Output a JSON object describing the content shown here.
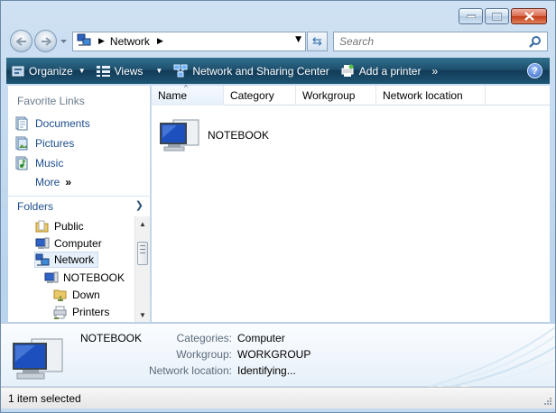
{
  "window": {
    "buttons": {
      "minimize": "minimize-icon",
      "maximize": "maximize-icon",
      "close": "close-icon"
    }
  },
  "address_bar": {
    "location": "Network",
    "search_placeholder": "Search"
  },
  "toolbar": {
    "organize": "Organize",
    "views": "Views",
    "network_sharing": "Network and Sharing Center",
    "add_printer": "Add a printer",
    "overflow": "»",
    "help": "?"
  },
  "favorites": {
    "title": "Favorite Links",
    "items": [
      {
        "label": "Documents",
        "icon": "documents-icon"
      },
      {
        "label": "Pictures",
        "icon": "pictures-icon"
      },
      {
        "label": "Music",
        "icon": "music-icon"
      }
    ],
    "more": "More",
    "more_arrows": "»"
  },
  "folders": {
    "title": "Folders",
    "tree": [
      {
        "label": "Public",
        "icon": "folder-icon",
        "level": 0
      },
      {
        "label": "Computer",
        "icon": "computer-icon",
        "level": 0
      },
      {
        "label": "Network",
        "icon": "network-icon",
        "level": 0,
        "selected": true
      },
      {
        "label": "NOTEBOOK",
        "icon": "computer-icon",
        "level": 1
      },
      {
        "label": "Down",
        "icon": "shared-folder-icon",
        "level": 2
      },
      {
        "label": "Printers",
        "icon": "printer-icon",
        "level": 2
      }
    ]
  },
  "columns": [
    "Name",
    "Category",
    "Workgroup",
    "Network location"
  ],
  "files": [
    {
      "name": "NOTEBOOK",
      "icon": "computer-icon"
    }
  ],
  "details": {
    "name": "NOTEBOOK",
    "categories_label": "Categories:",
    "categories_value": "Computer",
    "workgroup_label": "Workgroup:",
    "workgroup_value": "WORKGROUP",
    "location_label": "Network location:",
    "location_value": "Identifying..."
  },
  "status": {
    "text": "1 item selected"
  },
  "colors": {
    "toolbar": "#1d4f6d",
    "link": "#1e4e8c",
    "selection": "#e6f0fa"
  }
}
